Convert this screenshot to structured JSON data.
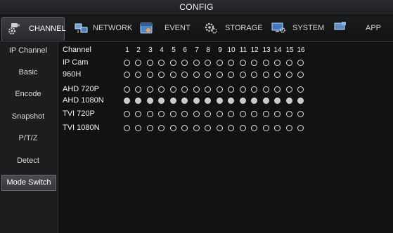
{
  "window": {
    "title": "CONFIG"
  },
  "tabs": [
    {
      "label": "CHANNEL",
      "icon": "camera-gear-icon",
      "active": true
    },
    {
      "label": "NETWORK",
      "icon": "network-icon"
    },
    {
      "label": "EVENT",
      "icon": "event-calendar-icon"
    },
    {
      "label": "STORAGE",
      "icon": "storage-gear-icon"
    },
    {
      "label": "SYSTEM",
      "icon": "system-monitor-icon"
    },
    {
      "label": "APP",
      "icon": "app-icon"
    }
  ],
  "sidebar": {
    "items": [
      {
        "label": "IP Channel"
      },
      {
        "label": "Basic"
      },
      {
        "label": "Encode"
      },
      {
        "label": "Snapshot"
      },
      {
        "label": "P/T/Z"
      },
      {
        "label": "Detect"
      },
      {
        "label": "Mode Switch",
        "active": true
      }
    ]
  },
  "grid": {
    "header": "Channel",
    "channels": [
      "1",
      "2",
      "3",
      "4",
      "5",
      "6",
      "7",
      "8",
      "9",
      "10",
      "11",
      "12",
      "13",
      "14",
      "15",
      "16"
    ],
    "modes": [
      {
        "label": "IP Cam",
        "selected": false
      },
      {
        "label": "960H",
        "selected": false
      },
      {
        "label": "AHD 720P",
        "selected": false
      },
      {
        "label": "AHD 1080N",
        "selected": true
      },
      {
        "label": "TVI 720P",
        "selected": false
      },
      {
        "label": "TVI 1080N",
        "selected": false
      }
    ]
  },
  "colors": {
    "background": "#111214",
    "accent": "#c9c9c9",
    "text": "#f2f2f2"
  }
}
